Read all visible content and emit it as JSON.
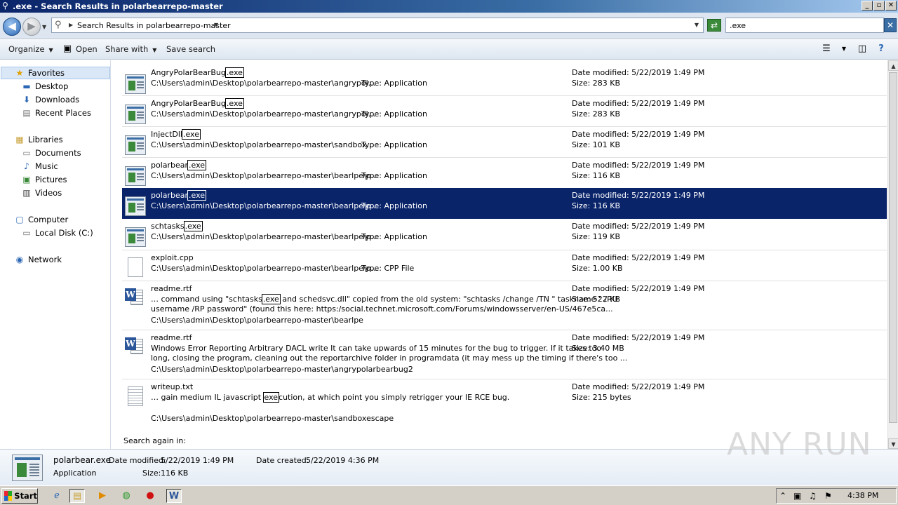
{
  "window": {
    "title": ".exe - Search Results in polarbearrepo-master",
    "controls": {
      "minimize": "_",
      "maximize": "▫",
      "close": "✕"
    }
  },
  "address": {
    "breadcrumb": "Search Results in polarbearrepo-master",
    "search_value": ".exe"
  },
  "commands": {
    "organize": "Organize",
    "open": "Open",
    "share_with": "Share with",
    "save_search": "Save search"
  },
  "nav": {
    "favorites": "Favorites",
    "desktop": "Desktop",
    "downloads": "Downloads",
    "recent_places": "Recent Places",
    "libraries": "Libraries",
    "documents": "Documents",
    "music": "Music",
    "pictures": "Pictures",
    "videos": "Videos",
    "computer": "Computer",
    "local_disk": "Local Disk (C:)",
    "network": "Network"
  },
  "results": [
    {
      "name_pre": "AngryPolarBearBug",
      "name_hl": ".exe",
      "path": "C:\\Users\\admin\\Desktop\\polarbearrepo-master\\angrypol...",
      "type": "Type: Application",
      "modified": "Date modified: 5/22/2019 1:49 PM",
      "size": "Size: 283 KB"
    },
    {
      "name_pre": "AngryPolarBearBug",
      "name_hl": ".exe",
      "path": "C:\\Users\\admin\\Desktop\\polarbearrepo-master\\angrypol...",
      "type": "Type: Application",
      "modified": "Date modified: 5/22/2019 1:49 PM",
      "size": "Size: 283 KB"
    },
    {
      "name_pre": "InjectDll",
      "name_hl": ".exe",
      "path": "C:\\Users\\admin\\Desktop\\polarbearrepo-master\\sandbox...",
      "type": "Type: Application",
      "modified": "Date modified: 5/22/2019 1:49 PM",
      "size": "Size: 101 KB"
    },
    {
      "name_pre": "polarbear",
      "name_hl": ".exe",
      "path": "C:\\Users\\admin\\Desktop\\polarbearrepo-master\\bearlpe\\p...",
      "type": "Type: Application",
      "modified": "Date modified: 5/22/2019 1:49 PM",
      "size": "Size: 116 KB"
    },
    {
      "name_pre": "polarbear",
      "name_hl": ".exe",
      "path": "C:\\Users\\admin\\Desktop\\polarbearrepo-master\\bearlpe\\p...",
      "type": "Type: Application",
      "modified": "Date modified: 5/22/2019 1:49 PM",
      "size": "Size: 116 KB"
    },
    {
      "name_pre": "schtasks",
      "name_hl": ".exe",
      "path": "C:\\Users\\admin\\Desktop\\polarbearrepo-master\\bearlpe\\p...",
      "type": "Type: Application",
      "modified": "Date modified: 5/22/2019 1:49 PM",
      "size": "Size: 119 KB"
    },
    {
      "name": "exploit.cpp",
      "path": "C:\\Users\\admin\\Desktop\\polarbearrepo-master\\bearlpe\\p...",
      "type": "Type: CPP File",
      "modified": "Date modified: 5/22/2019 1:49 PM",
      "size": "Size: 1.00 KB"
    },
    {
      "name": "readme.rtf",
      "snippet1_pre": "… command using \"schtasks",
      "snippet1_hl": ".exe",
      "snippet1_post": " and schedsvc.dll\" copied from the old system: \"schtasks /change /TN \" taskname \" /RU",
      "snippet2": "username /RP password\" (found this here: https:/social.technet.microsoft.com/Forums/windowsserver/en-US/467e5ca...",
      "path": "C:\\Users\\admin\\Desktop\\polarbearrepo-master\\bearlpe",
      "modified": "Date modified: 5/22/2019 1:49 PM",
      "size": "Size: 522 KB"
    },
    {
      "name": "readme.rtf",
      "snippet1": "Windows Error Reporting Arbitrary DACL write It can take upwards of 15 minutes for the bug to trigger. If it takes too",
      "snippet2": "long, closing the program, cleaning out the reportarchive folder in programdata (it may mess up the timing if there's too ...",
      "path": "C:\\Users\\admin\\Desktop\\polarbearrepo-master\\angrypolarbearbug2",
      "modified": "Date modified: 5/22/2019 1:49 PM",
      "size": "Size: 3.40 MB"
    },
    {
      "name": "writeup.txt",
      "snippet1_pre": "… gain medium IL javascript ",
      "snippet1_hl": "exe",
      "snippet1_post": "cution, at which point you simply retrigger your IE RCE bug.",
      "path": "C:\\Users\\admin\\Desktop\\polarbearrepo-master\\sandboxescape",
      "modified": "Date modified: 5/22/2019 1:49 PM",
      "size": "Size: 215 bytes"
    }
  ],
  "search_again": "Search again in:",
  "details": {
    "name": "polarbear.exe",
    "modified_label": "Date modified:",
    "modified_value": "5/22/2019 1:49 PM",
    "created_label": "Date created:",
    "created_value": "5/22/2019 4:36 PM",
    "type": "Application",
    "size_label": "Size:",
    "size_value": "116 KB"
  },
  "watermark": "ANY RUN",
  "taskbar": {
    "start": "Start",
    "clock": "4:38 PM"
  },
  "colors": {
    "selection": "#0a246a",
    "titlebar": "#0a246a"
  }
}
